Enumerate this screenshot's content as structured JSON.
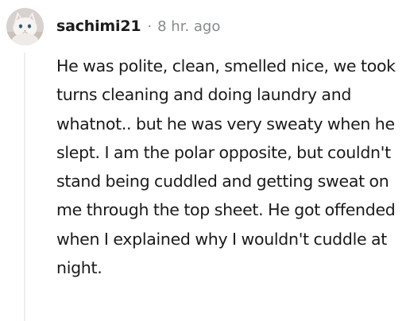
{
  "comment": {
    "username": "sachimi21",
    "separator": "·",
    "timestamp": "8 hr. ago",
    "body": "He was polite, clean, smelled nice, we took turns cleaning and doing laundry and whatnot.. but he was very sweaty when he slept. I am the polar opposite, but couldn't stand being cuddled and getting sweat on me through the top sheet. He got offended when I explained why I wouldn't cuddle at night."
  },
  "icons": {
    "avatar": "white-cat-avatar"
  },
  "colors": {
    "text": "#1a1a1b",
    "meta": "#878a8c",
    "thread_line": "#edeff1"
  }
}
